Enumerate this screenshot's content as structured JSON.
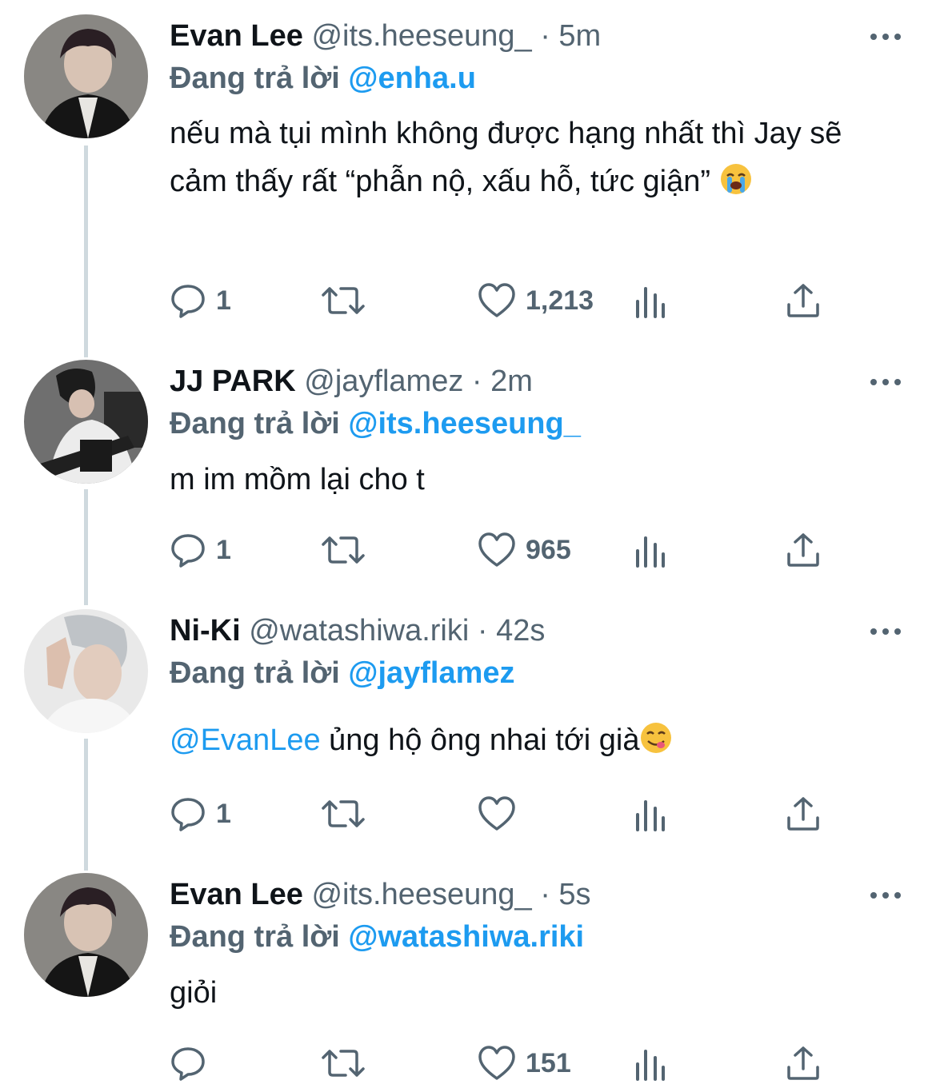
{
  "reply_prefix": "Đang trả lời",
  "colors": {
    "link": "#1d9bf0",
    "muted": "#536471",
    "text": "#0f1419",
    "thread": "#cfd9de"
  },
  "tweets": [
    {
      "name": "Evan Lee",
      "handle": "@its.heeseung_",
      "dot": "·",
      "time": "5m",
      "reply_to": "@enha.u",
      "text": "nếu mà tụi mình không được hạng nhất thì Jay sẽ cảm thấy rất “phẫn nộ, xấu hỗ, tức giận” ",
      "emoji": "loudly-crying-face",
      "replies": "1",
      "retweets": "",
      "likes": "1,213"
    },
    {
      "name": "JJ PARK",
      "handle": "@jayflamez",
      "dot": "·",
      "time": "2m",
      "reply_to": "@its.heeseung_",
      "text": "m im mồm lại cho t",
      "replies": "1",
      "retweets": "",
      "likes": "965"
    },
    {
      "name": "Ni-Ki",
      "handle": "@watashiwa.riki",
      "dot": "·",
      "time": "42s",
      "reply_to": "@jayflamez",
      "mention": "@EvanLee",
      "text": " ủng hộ ông nhai tới già",
      "emoji": "face-savoring-food",
      "replies": "1",
      "retweets": "",
      "likes": ""
    },
    {
      "name": "Evan Lee",
      "handle": "@its.heeseung_",
      "dot": "·",
      "time": "5s",
      "reply_to": "@watashiwa.riki",
      "text": "giỏi",
      "replies": "",
      "retweets": "",
      "likes": "151"
    }
  ],
  "icons": [
    "reply-icon",
    "retweet-icon",
    "like-icon",
    "analytics-icon",
    "share-icon",
    "more-icon"
  ]
}
